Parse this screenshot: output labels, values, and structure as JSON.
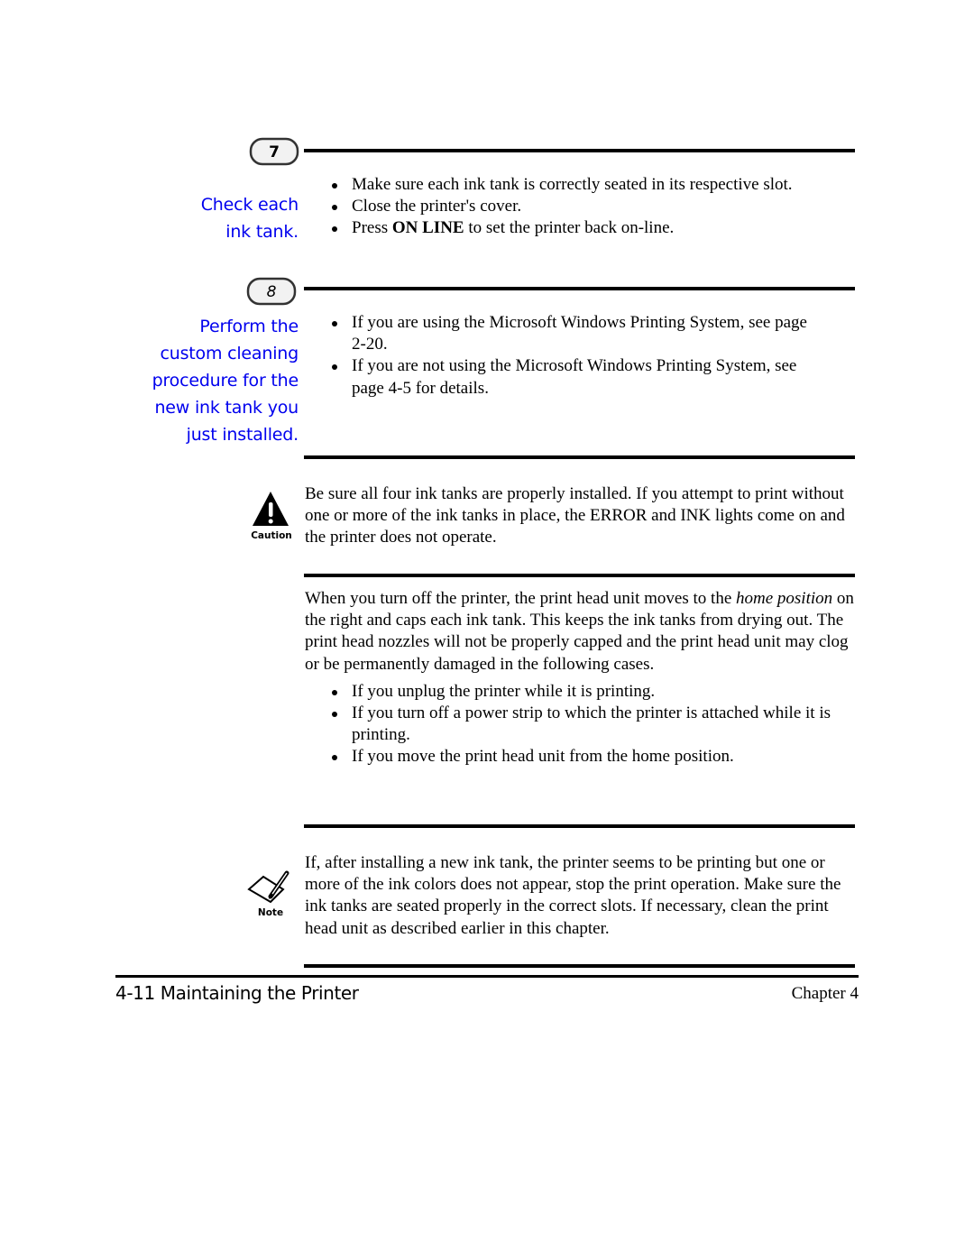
{
  "steps": [
    {
      "number": "7",
      "side_heading": [
        "Check each",
        "ink tank."
      ],
      "bullets": [
        {
          "parts": [
            {
              "text": "Make sure each ink tank is correctly seated in its respective slot.",
              "style": "normal"
            }
          ]
        },
        {
          "parts": [
            {
              "text": "Close the printer's cover.",
              "style": "normal"
            }
          ]
        },
        {
          "parts": [
            {
              "text": "Press ",
              "style": "normal"
            },
            {
              "text": "ON LINE",
              "style": "bold"
            },
            {
              "text": " to set the printer back on-line.",
              "style": "normal"
            }
          ]
        }
      ]
    },
    {
      "number": "8",
      "side_heading": [
        "Perform the",
        "custom cleaning",
        "procedure for the",
        "new ink tank you",
        "just installed."
      ],
      "bullets": [
        {
          "parts": [
            {
              "text": "If you are using the Microsoft Windows Printing System, see page 2-20.",
              "style": "normal"
            }
          ]
        },
        {
          "parts": [
            {
              "text": "If you are not using the Microsoft Windows Printing System, see page 4-5 for details.",
              "style": "normal"
            }
          ]
        }
      ]
    }
  ],
  "caution": {
    "icon": "caution-triangle-icon",
    "icon_label": "Caution",
    "text": "Be sure all four ink tanks are properly installed. If you attempt to print without one or more of the ink tanks in place, the ERROR and INK lights come on and the printer does not operate."
  },
  "home_position": {
    "paragraph_parts": [
      {
        "text": "When you turn off the printer, the print head unit moves to the ",
        "style": "normal"
      },
      {
        "text": "home position",
        "style": "italic"
      },
      {
        "text": " on the right and caps each ink tank. This keeps the ink tanks from drying out. The print head nozzles will not be properly capped and the print head unit may clog or be permanently damaged in the following cases.",
        "style": "normal"
      }
    ],
    "bullets": [
      "If you unplug the printer while it is printing.",
      "If you turn off a power strip to which the printer is attached while it is printing.",
      "If you move the print head unit from the home position."
    ]
  },
  "note": {
    "icon": "note-pencil-icon",
    "icon_label": "Note",
    "text": "If, after installing a new ink tank, the printer seems to be printing but one or more of the ink colors does not appear, stop the print operation. Make sure the ink tanks are seated properly in the correct slots. If necessary, clean the print head unit as described earlier in this chapter."
  },
  "footer": {
    "page_title": "4-11 Maintaining the Printer",
    "chapter": "Chapter 4"
  },
  "colors": {
    "side_heading": "#0000ee",
    "text": "#000000"
  }
}
